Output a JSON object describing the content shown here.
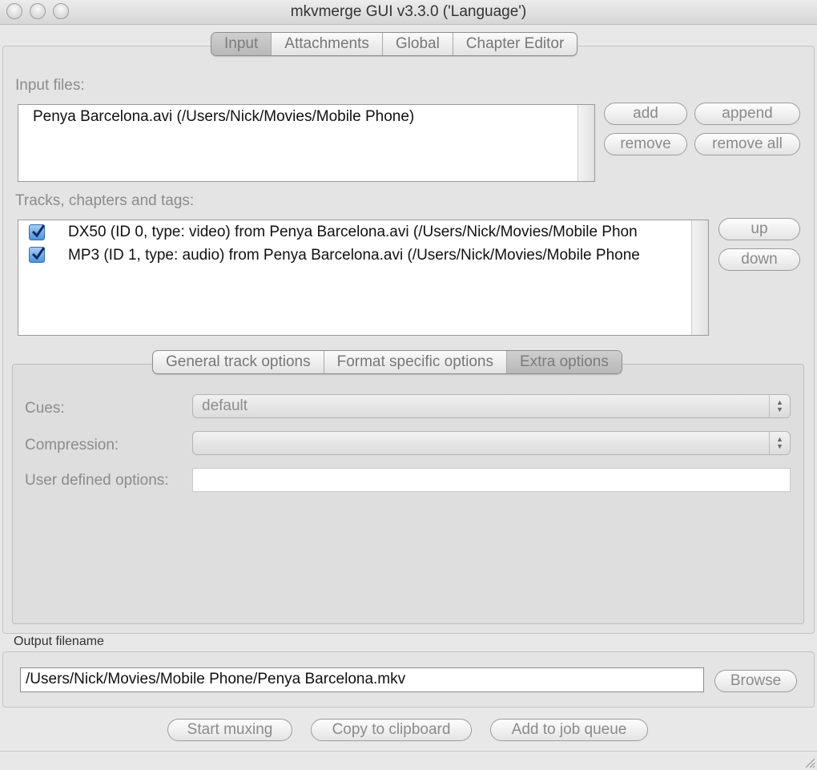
{
  "window": {
    "title": "mkvmerge GUI v3.3.0 ('Language')"
  },
  "main_tabs": [
    "Input",
    "Attachments",
    "Global",
    "Chapter Editor"
  ],
  "input_files": {
    "label": "Input files:",
    "items": [
      "Penya Barcelona.avi (/Users/Nick/Movies/Mobile Phone)"
    ],
    "buttons": {
      "add": "add",
      "append": "append",
      "remove": "remove",
      "remove_all": "remove all"
    }
  },
  "tracks": {
    "label": "Tracks, chapters and tags:",
    "items": [
      {
        "text": "DX50 (ID 0, type: video) from Penya Barcelona.avi (/Users/Nick/Movies/Mobile Phon",
        "checked": true
      },
      {
        "text": "MP3 (ID 1, type: audio) from Penya Barcelona.avi (/Users/Nick/Movies/Mobile Phone",
        "checked": true
      }
    ],
    "buttons": {
      "up": "up",
      "down": "down"
    }
  },
  "option_tabs": [
    "General track options",
    "Format specific options",
    "Extra options"
  ],
  "extra_options": {
    "cues_label": "Cues:",
    "cues_value": "default",
    "compression_label": "Compression:",
    "compression_value": "",
    "user_defined_label": "User defined options:",
    "user_defined_value": ""
  },
  "output": {
    "label": "Output filename",
    "value": "/Users/Nick/Movies/Mobile Phone/Penya Barcelona.mkv",
    "browse": "Browse"
  },
  "actions": {
    "start": "Start muxing",
    "copy": "Copy to clipboard",
    "queue": "Add to job queue"
  }
}
